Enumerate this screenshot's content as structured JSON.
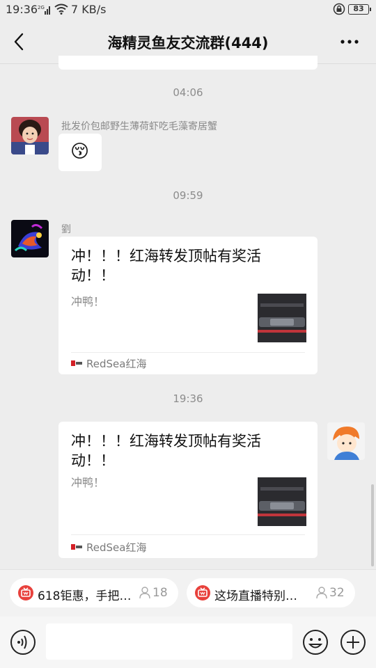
{
  "status_bar": {
    "time": "19:36",
    "network": "7 KB/s",
    "battery": "83"
  },
  "header": {
    "title": "海精灵鱼友交流群(444)"
  },
  "messages": {
    "ts1": "04:06",
    "msg1": {
      "sender": "批发价包邮野生薄荷虾吃毛藻寄居蟹",
      "emoji": "😚"
    },
    "ts2": "09:59",
    "msg2": {
      "sender": "劉",
      "card": {
        "title": "冲！！！红海转发顶帖有奖活动！！",
        "desc": "冲鸭！",
        "source": "RedSea红海"
      }
    },
    "ts3": "19:36",
    "msg3": {
      "card": {
        "title": "冲！！！红海转发顶帖有奖活动！！",
        "desc": "冲鸭！",
        "source": "RedSea红海"
      }
    }
  },
  "quick_bar": {
    "chips": [
      {
        "label": "618钜惠，手把…",
        "count": "18"
      },
      {
        "label": "这场直播特别…",
        "count": "32"
      }
    ]
  },
  "input": {
    "placeholder": ""
  },
  "colors": {
    "background": "#ededed",
    "bubble": "#ffffff",
    "chip_icon": "#e8413c"
  }
}
